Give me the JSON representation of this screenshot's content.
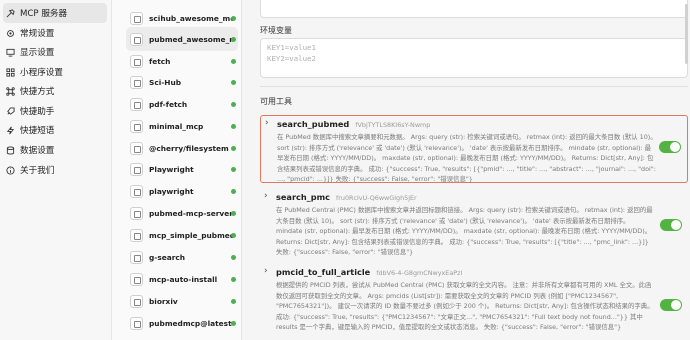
{
  "nav": {
    "items": [
      {
        "label": "MCP 服务器",
        "icon": "hammer-icon"
      },
      {
        "label": "常规设置",
        "icon": "gear-icon"
      },
      {
        "label": "显示设置",
        "icon": "monitor-icon"
      },
      {
        "label": "小程序设置",
        "icon": "grid-icon"
      },
      {
        "label": "快捷方式",
        "icon": "command-icon"
      },
      {
        "label": "快捷助手",
        "icon": "rocket-icon"
      },
      {
        "label": "快捷短语",
        "icon": "zap-icon"
      },
      {
        "label": "数据设置",
        "icon": "database-icon"
      },
      {
        "label": "关于我们",
        "icon": "info-icon"
      }
    ]
  },
  "servers": [
    {
      "name": "scihub_awesome_mcp..."
    },
    {
      "name": "pubmed_awesome_mcp..."
    },
    {
      "name": "fetch"
    },
    {
      "name": "Sci-Hub"
    },
    {
      "name": "pdf-fetch"
    },
    {
      "name": "minimal_mcp"
    },
    {
      "name": "@cherry/filesystem"
    },
    {
      "name": "Playwright"
    },
    {
      "name": "playwright"
    },
    {
      "name": "pubmed-mcp-server"
    },
    {
      "name": "mcp_simple_pubmed"
    },
    {
      "name": "g-search"
    },
    {
      "name": "mcp-auto-install"
    },
    {
      "name": "biorxiv"
    },
    {
      "name": "pubmedmcp@latest"
    }
  ],
  "main": {
    "env_label": "环境变量",
    "env_placeholder_line1": "KEY1=value1",
    "env_placeholder_line2": "KEY2=value2",
    "tools_label": "可用工具",
    "tools": [
      {
        "name": "search_pubmed",
        "id": "fVbjTYTLS8KI6sY-Nwmp",
        "description": "在 PubMed 数据库中搜索文章摘要和元数据。 Args: query (str): 检索关键词或语句。 retmax (int): 返回的最大条目数 (默认 10)。 sort (str): 排序方式 ('relevance' 或 'date') (默认 'relevance')。 'date' 表示按最新发布日期排序。 mindate (str, optional): 最早发布日期 (格式: YYYY/MM/DD)。 maxdate (str, optional): 最晚发布日期 (格式: YYYY/MM/DD)。 Returns: Dict[str, Any]: 包含结果列表或错误信息的字典。 成功: {\"success\": True, \"results\": [{\"pmid\": ..., \"title\": ..., \"abstract\": ..., \"journal\": ..., \"doi\": ..., \"pmcid\": ...}]} 失败: {\"success\": False, \"error\": \"错误信息\"}",
        "enabled": true
      },
      {
        "name": "search_pmc",
        "id": "fru0RclvU-Q6wwGlgh5jEr",
        "description": "在 PubMed Central (PMC) 数据库中搜索文章并返回标题和链接。 Args: query (str): 检索关键词或语句。 retmax (int): 返回的最大条目数 (默认 10)。 sort (str): 排序方式 ('relevance' 或 'date') (默认 'relevance')。 'date' 表示按最新发布日期排序。 mindate (str, optional): 最早发布日期 (格式: YYYY/MM/DD)。 maxdate (str, optional): 最晚发布日期 (格式: YYYY/MM/DD)。 Returns: Dict[str, Any]: 包含结果列表或错误信息的字典。 成功: {\"success\": True, \"results\": [{\"title\": ..., \"pmc_link\": ...}]} 失败: {\"success\": False, \"error\": \"错误信息\"}",
        "enabled": true
      },
      {
        "name": "pmcid_to_full_article",
        "id": "fdbV6-4-G8gmCNwyxEaPzl",
        "description": "根据提供的 PMCID 列表，尝试从 PubMed Central (PMC) 获取文章的全文内容。 注意：并非所有文章都有可用的 XML 全文。此函数仅返回可获取到全文的文章。 Args: pmcids (List[str]): 需要获取全文的文章的 PMCID 列表 (例如 [\"PMC1234567\", \"PMC7654321\"])。 建议一次请求的 ID 数量不要过多 (例如少于 200 个)。 Returns: Dict[str, Any]: 包含操作状态和结果的字典。 成功: {\"success\": True, \"results\": {\"PMC1234567\": \"文章正文...\", \"PMC7654321\": \"Full text body not found...\"}} 其中 results 是一个字典，键是输入的 PMCID，值是提取的全文或状态消息。 失败: {\"success\": False, \"error\": \"错误信息\"}",
        "enabled": true
      }
    ]
  },
  "colors": {
    "toggle_on": "#52b343",
    "highlight_border": "#e07a5f",
    "status_dot": "#4caf50"
  }
}
